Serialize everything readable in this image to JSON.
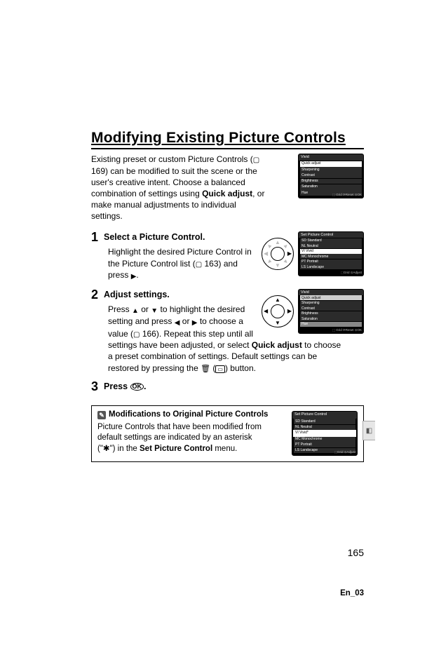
{
  "heading": "Modifying Existing Picture Controls",
  "intro": {
    "t1": "Existing preset or custom Picture Controls (",
    "ref1": " 169) can be modified to suit the scene or the user's creative intent.  Choose a balanced combination of settings using ",
    "bold1": "Quick adjust",
    "t2": ", or make manual adjustments to individual settings."
  },
  "screen_vivid": {
    "title": "Vivid",
    "rows": [
      "Quick adjust",
      "Sharpening",
      "Contrast",
      "Brightness",
      "Saturation",
      "Hue"
    ],
    "footer": "⬚ Grid  ⟳Reset  ⊙OK"
  },
  "screen_set": {
    "title": "Set Picture Control",
    "rows": [
      "SD Standard",
      "NL Neutral",
      "VI Vivid",
      "MC Monochrome",
      "PT Portrait",
      "LS Landscape"
    ],
    "footer": "⬚Grid  ⊙Adjust"
  },
  "screen_vivid2": {
    "title": "Vivid",
    "rows": [
      "Quick adjust",
      "Sharpening",
      "Contrast",
      "Brightness",
      "Saturation",
      "Hue"
    ],
    "footer": "⬚ Grid  ⟳Reset  ⊙OK"
  },
  "screen_set2": {
    "title": "Set Picture Control",
    "rows": [
      "SD Standard",
      "NL Neutral",
      "VI  Vivid*",
      "MC Monochrome",
      "PT Portrait",
      "LS Landscape"
    ],
    "footer": "⬚Grid  ⊙Adjust"
  },
  "steps": [
    {
      "num": "1",
      "title": "Select a Picture Control.",
      "body_a": "Highlight the desired Picture Control in the Picture Control list (",
      "ref": " 163) and press ",
      "body_b": "."
    },
    {
      "num": "2",
      "title": "Adjust settings.",
      "body_a": "Press ",
      "body_b": " or ",
      "body_c": " to highlight the desired setting and press ",
      "body_d": " or ",
      "body_e": " to choose a value (",
      "ref": " 166). Repeat this step until all settings have been adjusted, or select ",
      "bold": "Quick adjust",
      "body_f": " to choose a preset combination of settings.  Default settings can be restored by pressing the ",
      "body_g": " (",
      "body_h": ") button."
    },
    {
      "num": "3",
      "title_a": "Press ",
      "title_b": "."
    }
  ],
  "info": {
    "heading": "Modifications to Original Picture Controls",
    "body_a": "Picture Controls that have been modified from default settings are indicated by an asterisk (\"",
    "ast": "✱",
    "body_b": "\") in the ",
    "bold": "Set Picture Control",
    "body_c": " menu."
  },
  "page_number": "165",
  "footer": "En_03"
}
